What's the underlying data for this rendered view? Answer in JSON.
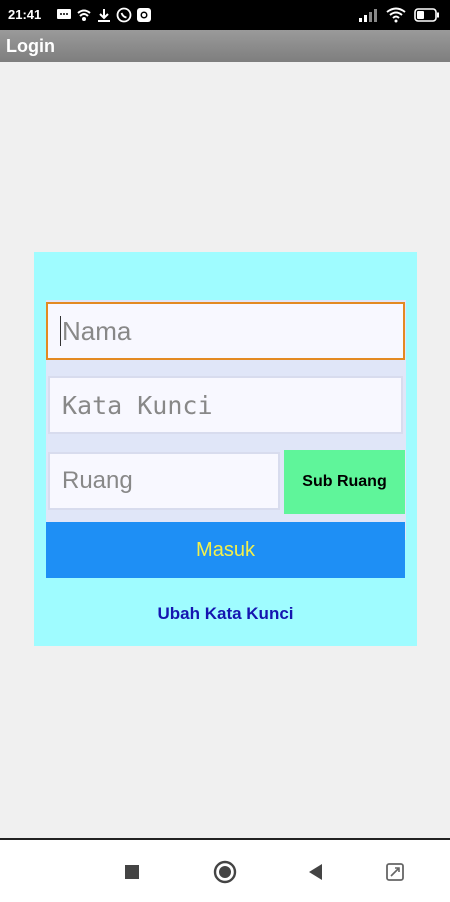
{
  "status_bar": {
    "time": "21:41",
    "icons_left": [
      "message-icon",
      "wifi-settings-icon",
      "download-icon",
      "whatsapp-icon",
      "camera-icon"
    ],
    "icons_right": [
      "signal-icon",
      "wifi-icon",
      "battery-icon"
    ]
  },
  "app_bar": {
    "title": "Login"
  },
  "login": {
    "nama_placeholder": "Nama",
    "kata_kunci_placeholder": "Kata Kunci",
    "ruang_placeholder": "Ruang",
    "sub_ruang_label": "Sub Ruang",
    "masuk_label": "Masuk",
    "ubah_label": "Ubah Kata Kunci"
  },
  "colors": {
    "card_bg": "#9ffcff",
    "masuk_bg": "#1e8ff5",
    "masuk_text": "#f3f04a",
    "sub_ruang_bg": "#5ff59a",
    "link_text": "#1515b0",
    "focus_border": "#e38a22"
  },
  "nav_bar": {
    "buttons": [
      "stop-square-icon",
      "home-circle-icon",
      "back-triangle-icon",
      "expand-icon"
    ]
  }
}
